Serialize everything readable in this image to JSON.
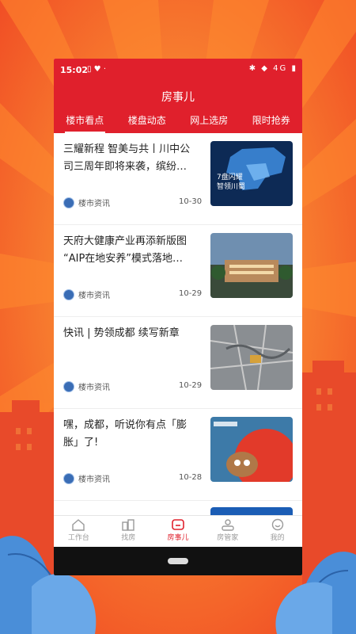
{
  "status": {
    "time": "15:02",
    "signal": "4G"
  },
  "header": {
    "title": "房事儿"
  },
  "tabs": [
    {
      "label": "楼市看点",
      "active": true
    },
    {
      "label": "楼盘动态"
    },
    {
      "label": "网上选房"
    },
    {
      "label": "限时抢券"
    }
  ],
  "feed": [
    {
      "title": "三耀新程 智美与共丨川中公司三周年即将来袭，缤纷…",
      "source": "楼市资讯",
      "date": "10-30",
      "thumb_text": "7盘闪耀\n智领川蜀"
    },
    {
      "title": "天府大健康产业再添新版图 “AIP在地安养”模式落地…",
      "source": "楼市资讯",
      "date": "10-29"
    },
    {
      "title": "快讯 | 势领成都 续写新章",
      "source": "楼市资讯",
      "date": "10-29"
    },
    {
      "title": "嘿，成都，听说你有点「膨胀」了!",
      "source": "楼市资讯",
      "date": "10-28"
    }
  ],
  "bottom_nav": [
    {
      "label": "工作台",
      "icon": "home-icon"
    },
    {
      "label": "找房",
      "icon": "buildings-icon"
    },
    {
      "label": "房事儿",
      "icon": "message-icon",
      "active": true
    },
    {
      "label": "房管家",
      "icon": "user-card-icon"
    },
    {
      "label": "我的",
      "icon": "smile-icon"
    }
  ],
  "colors": {
    "brand_red": "#e0202c",
    "bg_orange": "#f05a28"
  }
}
